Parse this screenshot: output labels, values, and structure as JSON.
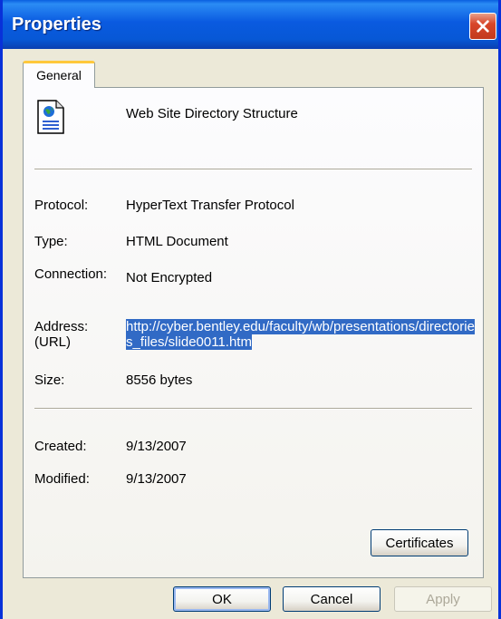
{
  "window": {
    "title": "Properties"
  },
  "tabs": [
    {
      "label": "General",
      "selected": true
    }
  ],
  "general": {
    "file_name": "Web Site Directory Structure",
    "icon": "html-document-icon",
    "protocol_label": "Protocol:",
    "protocol_value": "HyperText Transfer Protocol",
    "type_label": "Type:",
    "type_value": "HTML Document",
    "connection_label": "Connection:",
    "connection_value": "Not Encrypted",
    "address_label_line1": "Address:",
    "address_label_line2": "(URL)",
    "address_value": "http://cyber.bentley.edu/faculty/wb/presentations/directories_files/slide0011.htm",
    "size_label": "Size:",
    "size_value": "8556 bytes",
    "created_label": "Created:",
    "created_value": "9/13/2007",
    "modified_label": "Modified:",
    "modified_value": "9/13/2007",
    "certificates_label": "Certificates"
  },
  "buttons": {
    "ok": "OK",
    "cancel": "Cancel",
    "apply": "Apply"
  },
  "colors": {
    "titlebar": "#0a5ae0",
    "selection": "#316ac5",
    "dialog_bg": "#ece9d8",
    "close": "#d8472a"
  }
}
